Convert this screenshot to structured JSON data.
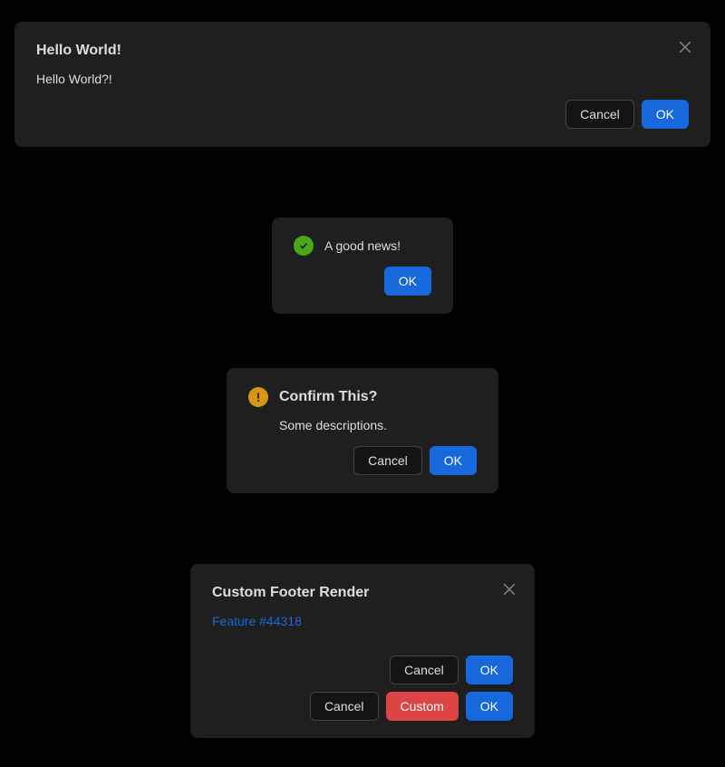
{
  "modal1": {
    "title": "Hello World!",
    "content": "Hello World?!",
    "cancel_label": "Cancel",
    "ok_label": "OK"
  },
  "modal2": {
    "icon": "check-circle-icon",
    "content": "A good news!",
    "ok_label": "OK"
  },
  "modal3": {
    "icon": "exclamation-circle-icon",
    "title": "Confirm This?",
    "content": "Some descriptions.",
    "cancel_label": "Cancel",
    "ok_label": "OK"
  },
  "modal4": {
    "title": "Custom Footer Render",
    "link_text": "Feature #44318",
    "footer_row1": {
      "cancel_label": "Cancel",
      "ok_label": "OK"
    },
    "footer_row2": {
      "cancel_label": "Cancel",
      "custom_label": "Custom",
      "ok_label": "OK"
    }
  },
  "colors": {
    "primary": "#1668dc",
    "danger": "#dc4446",
    "success": "#49aa19",
    "warning": "#d89614",
    "modal_bg": "#1f1f1f",
    "page_bg": "#000000"
  }
}
